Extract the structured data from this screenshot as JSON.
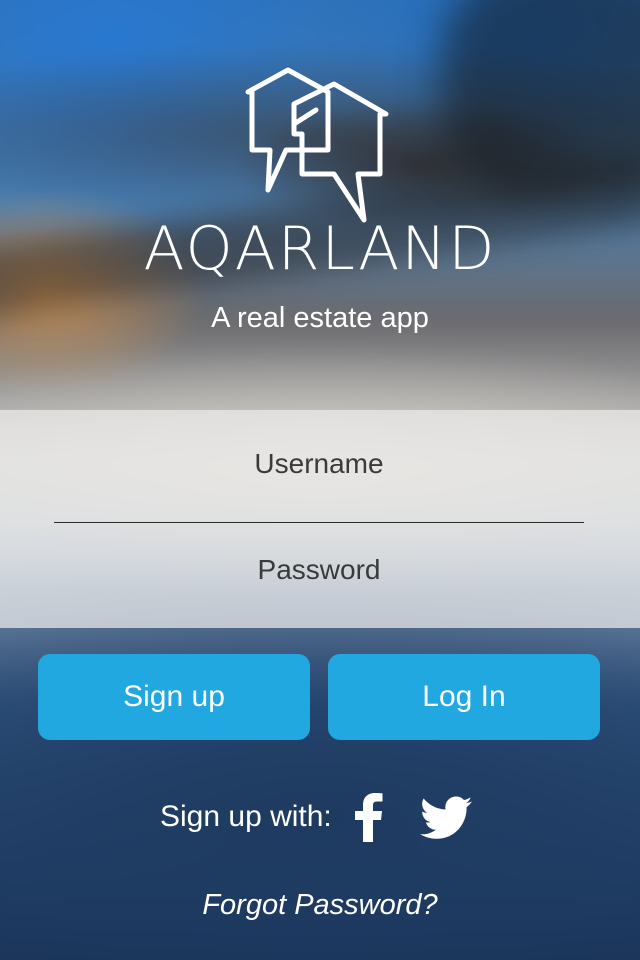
{
  "app": {
    "name": "AQARLAND",
    "tagline": "A real estate app"
  },
  "form": {
    "username_placeholder": "Username",
    "username_value": "",
    "password_placeholder": "Password",
    "password_value": ""
  },
  "buttons": {
    "signup_label": "Sign up",
    "login_label": "Log In"
  },
  "social": {
    "label": "Sign up with:",
    "icons": [
      "facebook-icon",
      "twitter-icon"
    ]
  },
  "links": {
    "forgot_password": "Forgot Password?"
  },
  "colors": {
    "accent": "#21a8e1",
    "text": "#ffffff",
    "form_panel": "#ebebeb"
  }
}
